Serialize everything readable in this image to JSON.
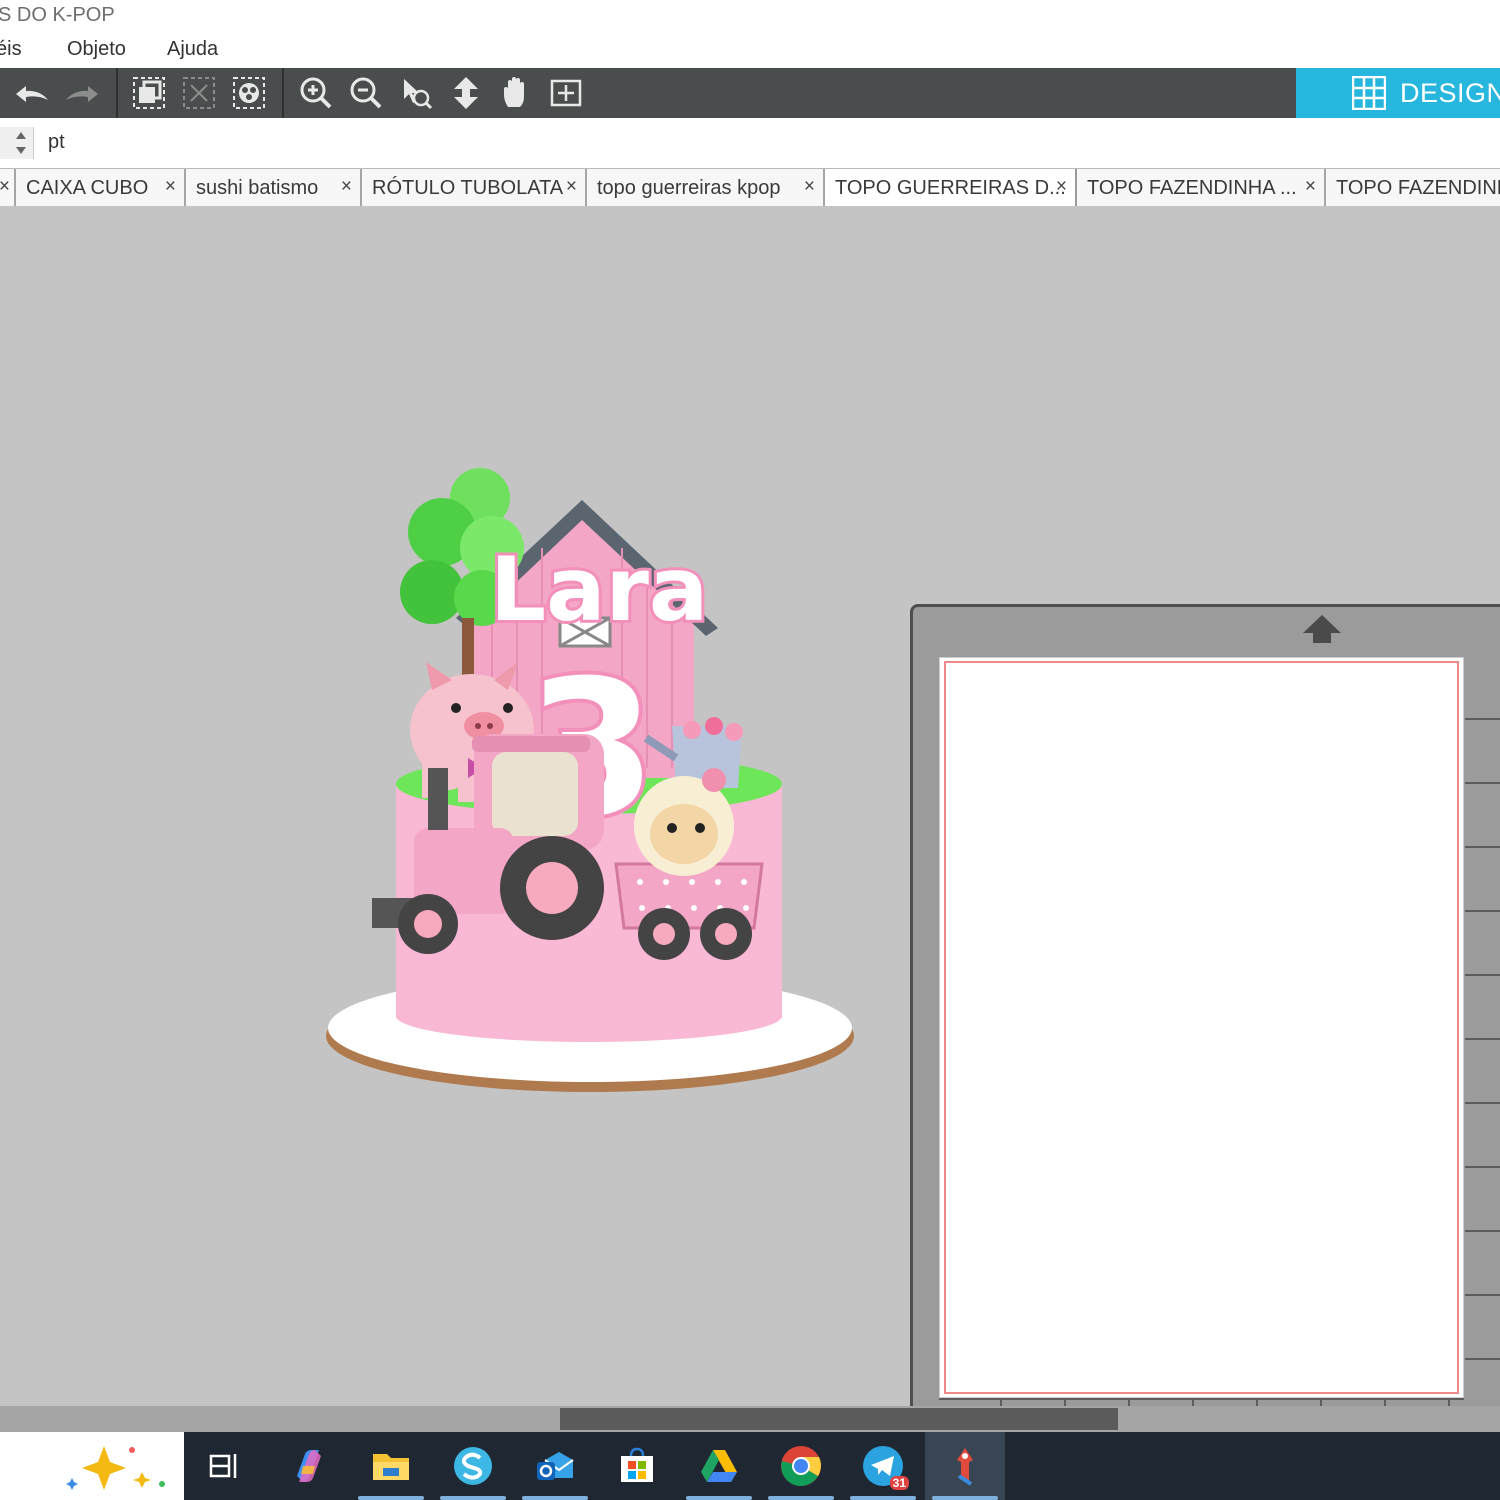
{
  "window": {
    "title": "S DO K-POP"
  },
  "menu": {
    "items": [
      "éis",
      "Objeto",
      "Ajuda"
    ]
  },
  "toolbar": {
    "design_label": "DESIGN",
    "accent_color": "#27b6dd"
  },
  "options": {
    "unit": "pt"
  },
  "tabs": [
    {
      "label": "CAIXA CUBO",
      "close": "×"
    },
    {
      "label": "sushi batismo",
      "close": "×"
    },
    {
      "label": "RÓTULO TUBOLATA",
      "close": "×"
    },
    {
      "label": "topo guerreiras kpop",
      "close": "×"
    },
    {
      "label": "TOPO GUERREIRAS D...",
      "close": "×"
    },
    {
      "label": "TOPO FAZENDINHA ...",
      "close": "×"
    },
    {
      "label": "TOPO FAZENDINHA"
    }
  ],
  "tab_leading_close": "×",
  "canvas": {
    "design_name_text": "Lara",
    "design_number_text": "3"
  },
  "taskbar": {
    "telegram_badge": "31"
  }
}
